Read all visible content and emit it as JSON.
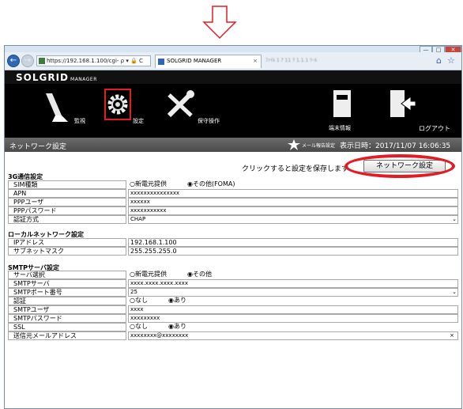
{
  "browser": {
    "address": "https://192.168.1.100/cgi-",
    "address_icons": "ρ ▾ 🔒 C",
    "tab_title": "SOLGRID MANAGER",
    "tab_close": "×",
    "blurred_text": "ﾌｧｲﾙ  1  ｱ  11  ｦ  1.1.1   ﾂｰﾙ",
    "window_controls": [
      "—",
      "□",
      "✕"
    ]
  },
  "app": {
    "logo": "SOLGRID",
    "logo_sub": "MANAGER",
    "menu": {
      "monitor_label": "監視",
      "settings_label": "設定",
      "maintenance_label": "保守操作",
      "device_info_label": "端末情報",
      "logout_label": "ログアウト"
    },
    "page_title": "ネットワーク設定",
    "mail_settings_label": "メール報告設定",
    "datetime": "表示日時：2017/11/07 16:06:35",
    "save_hint": "クリックすると設定を保存します",
    "save_button": "ネットワーク設定"
  },
  "sections": {
    "g3": {
      "title": "3G通信設定",
      "sim_label": "SIM種類",
      "sim_opt1": "○新電元提供",
      "sim_opt2": "◉その他(FOMA)",
      "apn_label": "APN",
      "apn_value": "xxxxxxxxxxxxxxx",
      "ppp_user_label": "PPPユーザ",
      "ppp_user_value": "xxxxxx",
      "ppp_pass_label": "PPPパスワード",
      "ppp_pass_value": "xxxxxxxxxxx",
      "auth_label": "認証方式",
      "auth_value": "CHAP"
    },
    "local": {
      "title": "ローカルネットワーク設定",
      "ip_label": "IPアドレス",
      "ip_value": "192.168.1.100",
      "mask_label": "サブネットマスク",
      "mask_value": "255.255.255.0"
    },
    "smtp": {
      "title": "SMTPサーバ設定",
      "server_sel_label": "サーバ選択",
      "server_opt1": "○新電元提供",
      "server_opt2": "◉その他",
      "server_label": "SMTPサーバ",
      "server_value": "xxxx.xxxx.xxxx.xxxx",
      "port_label": "SMTPポート番号",
      "port_value": "25",
      "auth_label": "認証",
      "auth_opt1": "○なし",
      "auth_opt2": "◉あり",
      "user_label": "SMTPユーザ",
      "user_value": "xxxx",
      "pass_label": "SMTPパスワード",
      "pass_value": "xxxxxxxxx",
      "ssl_label": "SSL",
      "ssl_opt1": "○なし",
      "ssl_opt2": "◉あり",
      "sender_label": "送信元メールアドレス",
      "sender_value": "xxxxxxxx@xxxxxxxx"
    }
  },
  "colors": {
    "highlight_red": "#e31b23",
    "app_bg": "#000000",
    "status_bar": "#5a5a5a"
  },
  "icons": [
    "down-arrow-icon",
    "back-icon",
    "forward-icon",
    "lock-icon",
    "home-icon",
    "star-icon",
    "broom-icon",
    "gear-icon",
    "tools-icon",
    "device-icon",
    "logout-door-icon",
    "mail-settings-icon",
    "dropdown-icon",
    "clear-icon"
  ]
}
